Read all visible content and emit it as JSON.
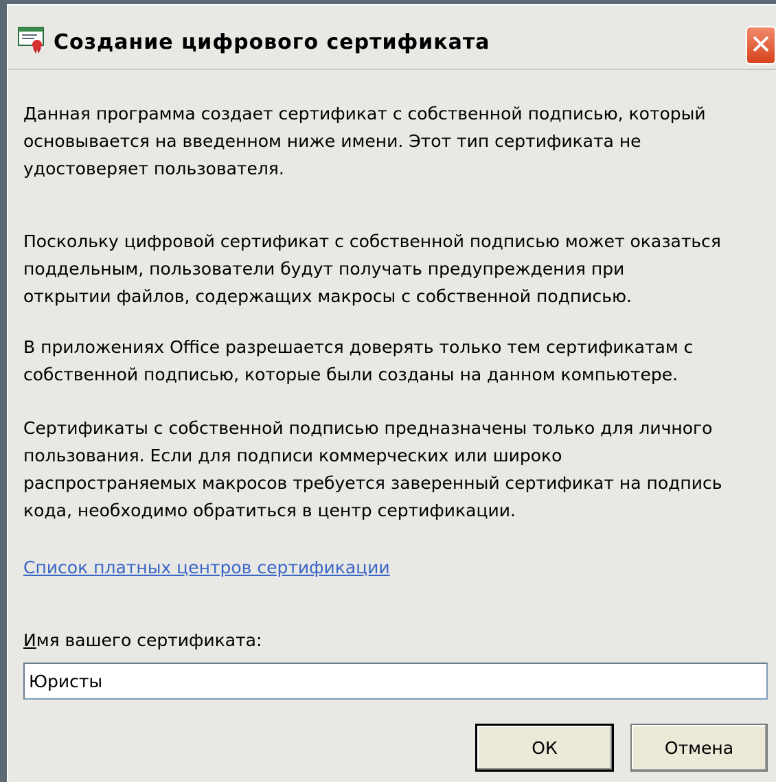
{
  "window": {
    "title": "Создание цифрового сертификата",
    "title_icon": "certificate-icon",
    "close_icon": "close-icon"
  },
  "content": {
    "paragraph_1": "Данная программа создает сертификат с собственной подписью, который\nосновывается на введенном ниже имени. Этот тип сертификата не\nудостоверяет пользователя.",
    "paragraph_2": "Поскольку цифровой сертификат с собственной подписью может оказаться\nподдельным, пользователи будут получать предупреждения при\nоткрытии файлов, содержащих макросы с собственной подписью.",
    "paragraph_3": "В приложениях Office разрешается доверять только тем сертификатам с\nсобственной подписью, которые были созданы на данном компьютере.",
    "paragraph_4": "Сертификаты с собственной подписью предназначены только для личного\nпользования. Если для подписи коммерческих или широко\nраспространяемых макросов требуется заверенный сертификат на подпись\nкода, необходимо обратиться в центр сертификации."
  },
  "link": {
    "text": "Список платных центров сертификации"
  },
  "name_field": {
    "label_accel": "И",
    "label_rest": "мя вашего сертификата:",
    "value": "Юристы"
  },
  "buttons": {
    "ok_label": "ОК",
    "cancel_label": "Отмена"
  },
  "colors": {
    "link": "#3a66c8",
    "close_button": "#d8431c"
  }
}
